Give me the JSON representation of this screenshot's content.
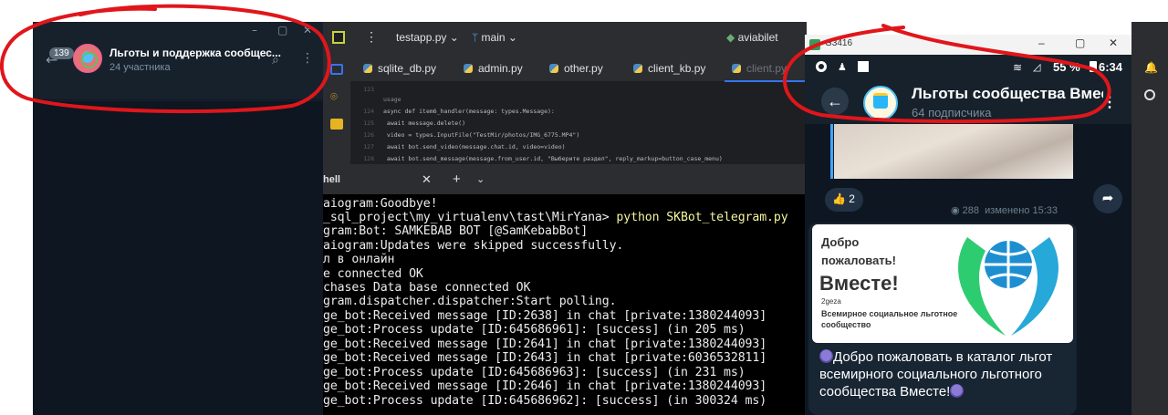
{
  "tg_desktop": {
    "unread_badge": "139",
    "chat_title": "Льготы и поддержка сообщес...",
    "chat_subtitle": "24 участника",
    "win_minimize": "–",
    "win_maximize": "▢",
    "win_close": "✕"
  },
  "ide": {
    "project_name": "testapp.py",
    "branch": "main",
    "run_config": "aviabilet",
    "tabs": [
      {
        "label": "sqlite_db.py"
      },
      {
        "label": "admin.py"
      },
      {
        "label": "other.py"
      },
      {
        "label": "client_kb.py"
      },
      {
        "label": "client.py"
      }
    ],
    "editor_lines": [
      {
        "num": "123",
        "code": ""
      },
      {
        "num": "",
        "code": "usage"
      },
      {
        "num": "124",
        "code": "async def item6_handler(message: types.Message):"
      },
      {
        "num": "125",
        "code": "    await message.delete()"
      },
      {
        "num": "126",
        "code": "    video = types.InputFile(\"TestMir/photos/IMG_6775.MP4\")"
      },
      {
        "num": "127",
        "code": "    await bot.send_video(message.chat.id, video=video)"
      },
      {
        "num": "128",
        "code": "    await bot.send_message(message.from_user.id, \"Выберите раздел\", reply_markup=button_case_menu)"
      }
    ],
    "terminal_tab": "hell",
    "terminal_lines": [
      "aiogram:Goodbye!",
      "_sql_project\\my_virtualenv\\tast\\MirYana> python SKBot_telegram.py",
      "gram:Bot: SAMKEBAB BOT [@SamKebabBot]",
      "aiogram:Updates were skipped successfully.",
      "л в онлайн",
      "e connected OK",
      "chases Data base connected OK",
      "gram.dispatcher.dispatcher:Start polling.",
      "ge_bot:Received message [ID:2638] in chat [private:1380244093]",
      "ge_bot:Process update [ID:645686961]: [success] (in 205 ms)",
      "ge_bot:Received message [ID:2641] in chat [private:1380244093]",
      "ge_bot:Received message [ID:2643] in chat [private:6036532811]",
      "ge_bot:Process update [ID:645686963]: [success] (in 231 ms)",
      "ge_bot:Received message [ID:2646] in chat [private:1380244093]",
      "ge_bot:Process update [ID:645686962]: [success] (in 300324 ms)"
    ],
    "terminal_command_prefix": "_sql_project\\my_virtualenv\\tast\\MirYana> ",
    "terminal_command": "python SKBot_telegram.py"
  },
  "phone": {
    "window_name": "G3416",
    "status_battery": "55 %",
    "status_time": "6:34",
    "channel_title": "Льготы сообщества Вместе",
    "channel_subtitle": "64 подписчика",
    "reaction_count": "2",
    "views": "288",
    "edited": "изменено 15:33",
    "banner_welcome": "Добро пожаловать!",
    "banner_brand": "Вместе!",
    "banner_small": "2geza",
    "banner_org": "Всемирное социальное льготное сообщество",
    "post_text": "Добро пожаловать в каталог льгот всемирного социального льготного сообщества Вместе!"
  },
  "colors": {
    "telegram_bg": "#17212b",
    "ide_bg": "#2b2d30",
    "terminal_bg": "#000000",
    "accent_blue": "#3574f0",
    "annotation_red": "#e0161b"
  }
}
